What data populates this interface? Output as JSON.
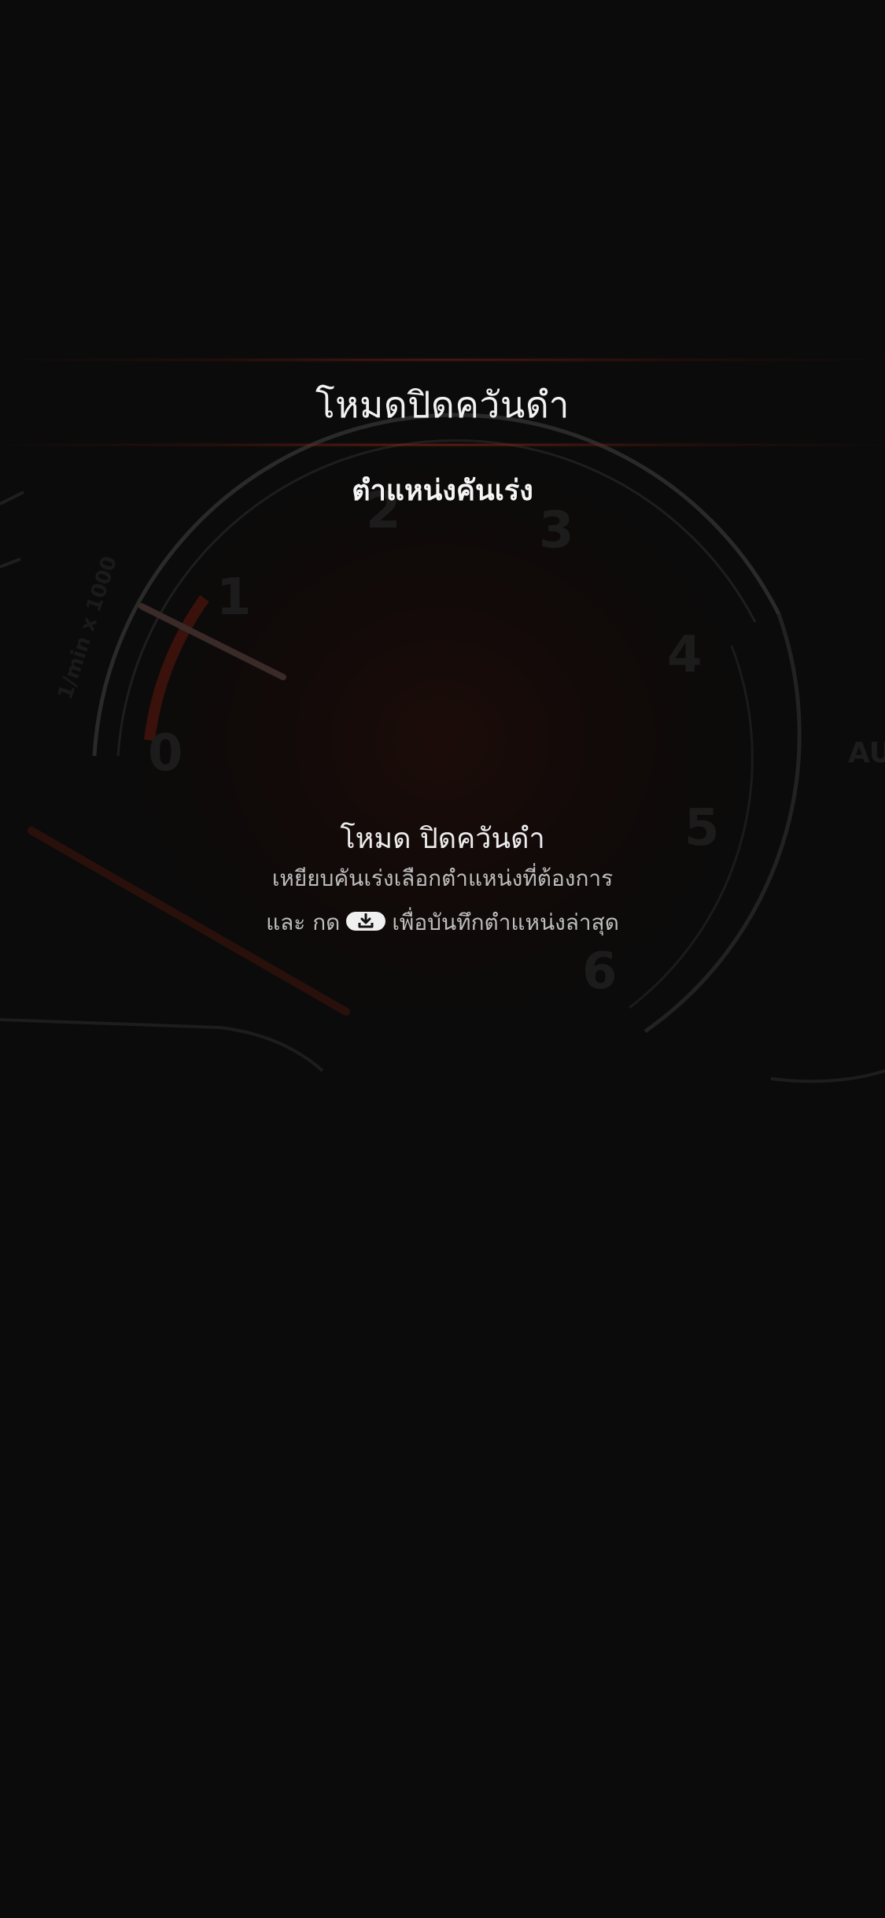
{
  "screen": {
    "title": "โหมดปิดควันดำ",
    "subtitle": "ตำแหน่งคันเร่ง",
    "mode_heading": "โหมด ปิดควันดำ",
    "instruction_line1": "เหยียบคันเร่งเลือกตำแหน่งที่ต้องการ",
    "instruction_line2_before": "และ กด",
    "instruction_line2_after": "เพื่อบันทึกตำแหน่งล่าสุด",
    "save_icon": "download-icon"
  },
  "background": {
    "gauge_numbers": [
      "0",
      "1",
      "2",
      "3",
      "4",
      "5",
      "6"
    ],
    "gauge_unit": "1/min x 1000",
    "side_label": "AU"
  },
  "colors": {
    "background": "#0b0b0b",
    "glow": "#a02a14",
    "text_primary": "#f2f2f2",
    "text_secondary": "#bdbdbd"
  }
}
